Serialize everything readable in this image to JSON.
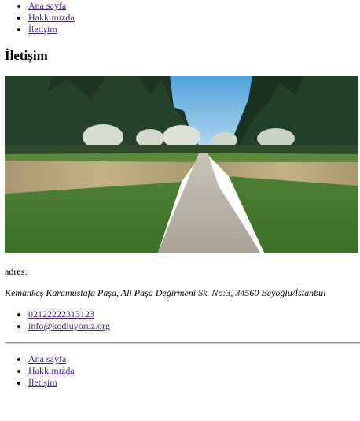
{
  "nav": {
    "items": [
      {
        "label": "Ana sayfa"
      },
      {
        "label": "Hakkımızda"
      },
      {
        "label": "İletişim"
      }
    ]
  },
  "page_title": "İletişim",
  "hero_image": {
    "alt": "",
    "colors": {
      "sky": "#7ec0e6",
      "forest": "#1f3a23",
      "grass": "#3f7a2c",
      "dry_grass": "#b8a57a",
      "path": "#b9b2a6"
    }
  },
  "address": {
    "label": "adres:",
    "value": "Kemankeş Karamustafa Paşa, Ali Paşa Değirmeni Sk. No:3, 34560 Beyoğlu/İstanbul"
  },
  "contact": {
    "phone": "02122222313123",
    "email": "info@kodluyoruz.org"
  },
  "footer_nav": {
    "items": [
      {
        "label": "Ana sayfa"
      },
      {
        "label": "Hakkımızda"
      },
      {
        "label": "İletişim"
      }
    ]
  }
}
